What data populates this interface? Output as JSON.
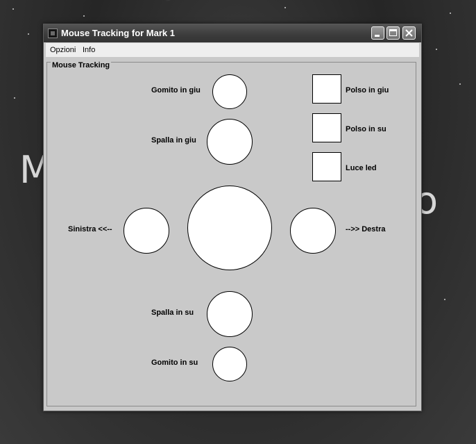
{
  "window": {
    "title": "Mouse Tracking for Mark 1"
  },
  "menu": {
    "items": [
      "Opzioni",
      "Info"
    ]
  },
  "panel": {
    "title": "Mouse Tracking"
  },
  "controls": {
    "gomito_giu": "Gomito in giu",
    "spalla_giu": "Spalla in giu",
    "sinistra": "Sinistra <<--",
    "destra": "-->> Destra",
    "spalla_su": "Spalla in su",
    "gomito_su": "Gomito in su",
    "polso_giu": "Polso in giu",
    "polso_su": "Polso in su",
    "luce_led": "Luce led"
  },
  "colors": {
    "panel_bg": "#c9c9c9",
    "button_fill": "#ffffff"
  }
}
